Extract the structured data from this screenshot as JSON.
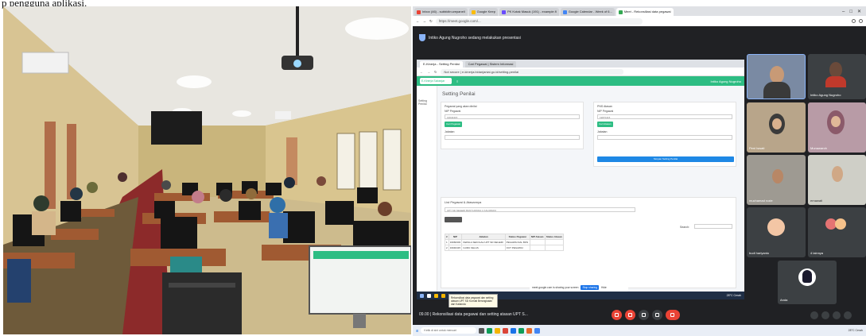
{
  "caption": "p pengguna aplikasi.",
  "browser": {
    "tabs": [
      {
        "label": "Inbox (46) - subbidtn.wepaneli",
        "color": "#ea4335"
      },
      {
        "label": "Google Keep",
        "color": "#fbbc04"
      },
      {
        "label": "PK Kotak Masuk (191) - example.fl",
        "color": "#6a4cff"
      },
      {
        "label": "Google Calendar - Week of 6...",
        "color": "#4285f4"
      },
      {
        "label": "Meet - Rekonsiliasi data pegawai",
        "color": "#34a853"
      }
    ],
    "url": "https://meet.google.com/..."
  },
  "meet": {
    "presenting_text": "Intiko Agung Nugroho sedang melakukan presentasi",
    "meeting_info": "09.00  |  Rekonsiliasi data pegawai dan setting atasan UPT S..."
  },
  "shared_screen": {
    "tabs": [
      "E-Kinerja - Setting Penilai",
      "Cari Pegawai | Sistem Informasi"
    ],
    "url_secure": "Not secure",
    "url": "e-kinerja.bidanjaniai.go.id/setting-penilai",
    "app_name": "E-Kinerja Sabanjar",
    "user_label": "Intiko Agung Nugroho",
    "sidebar_item": "Setting Penilai",
    "page_title": "Setting Penilai",
    "left_panel": {
      "title": "Pegawai yang akan dinilai",
      "nip_label": "NIP Pegawai",
      "nip_value": "19640415",
      "button": "Cari Pegawai",
      "jabatan_label": "Jabatan"
    },
    "right_panel": {
      "title": "PNS Atasan",
      "nip_label": "NIP Pegawai",
      "nip_value": "19870415",
      "button": "Cari Atasan",
      "jabatan_label": "Jabatan",
      "save_button": "Simpan Setting Penilai"
    },
    "list_title": "List Pegawai & Atasannya",
    "filter_value": "UPT SD NEGERI BANYUMUDA 1 KALIWADU",
    "search_label": "Search:",
    "table": {
      "headers": [
        "#",
        "NIP",
        "Jabatan",
        "Status Pegawai",
        "NIP Atasan",
        "Status Atasan"
      ],
      "rows": [
        [
          "1",
          "19660303",
          "KEPALA SEKOLAH UPT SD NEGERI",
          "PEGAWAI DAL BOS",
          "",
          ""
        ],
        [
          "2",
          "19640415",
          "GURU KELAS",
          "OUT PEGAWAI",
          "",
          ""
        ]
      ]
    },
    "share_text": "meet.google.com is sharing your screen",
    "stop_sharing": "Stop sharing",
    "hide": "Hide",
    "tooltip": "Rekonsiliasi data pegawai dan setting atasan UPT SD Kurnati Berangkatan dari Kalianda",
    "tray_text": "28°C Cerah"
  },
  "participants": [
    {
      "name": "",
      "self": true
    },
    {
      "name": "Intiko Agung Nugroho"
    },
    {
      "name": "Peni Iswati"
    },
    {
      "name": "Munawaroh"
    },
    {
      "name": "muchamad rozie"
    },
    {
      "name": "ernawati"
    },
    {
      "name": "budi hariyanto"
    },
    {
      "name": "4 lainnya"
    },
    {
      "name": "Anda"
    }
  ],
  "host_taskbar": {
    "search_placeholder": "Ketik di sini untuk mencari",
    "tray": "28°C Cerah"
  },
  "colors": {
    "accent_green": "#2dbd83",
    "meet_dark": "#202124",
    "end_call": "#ea4335",
    "link_blue": "#1a73e8"
  }
}
